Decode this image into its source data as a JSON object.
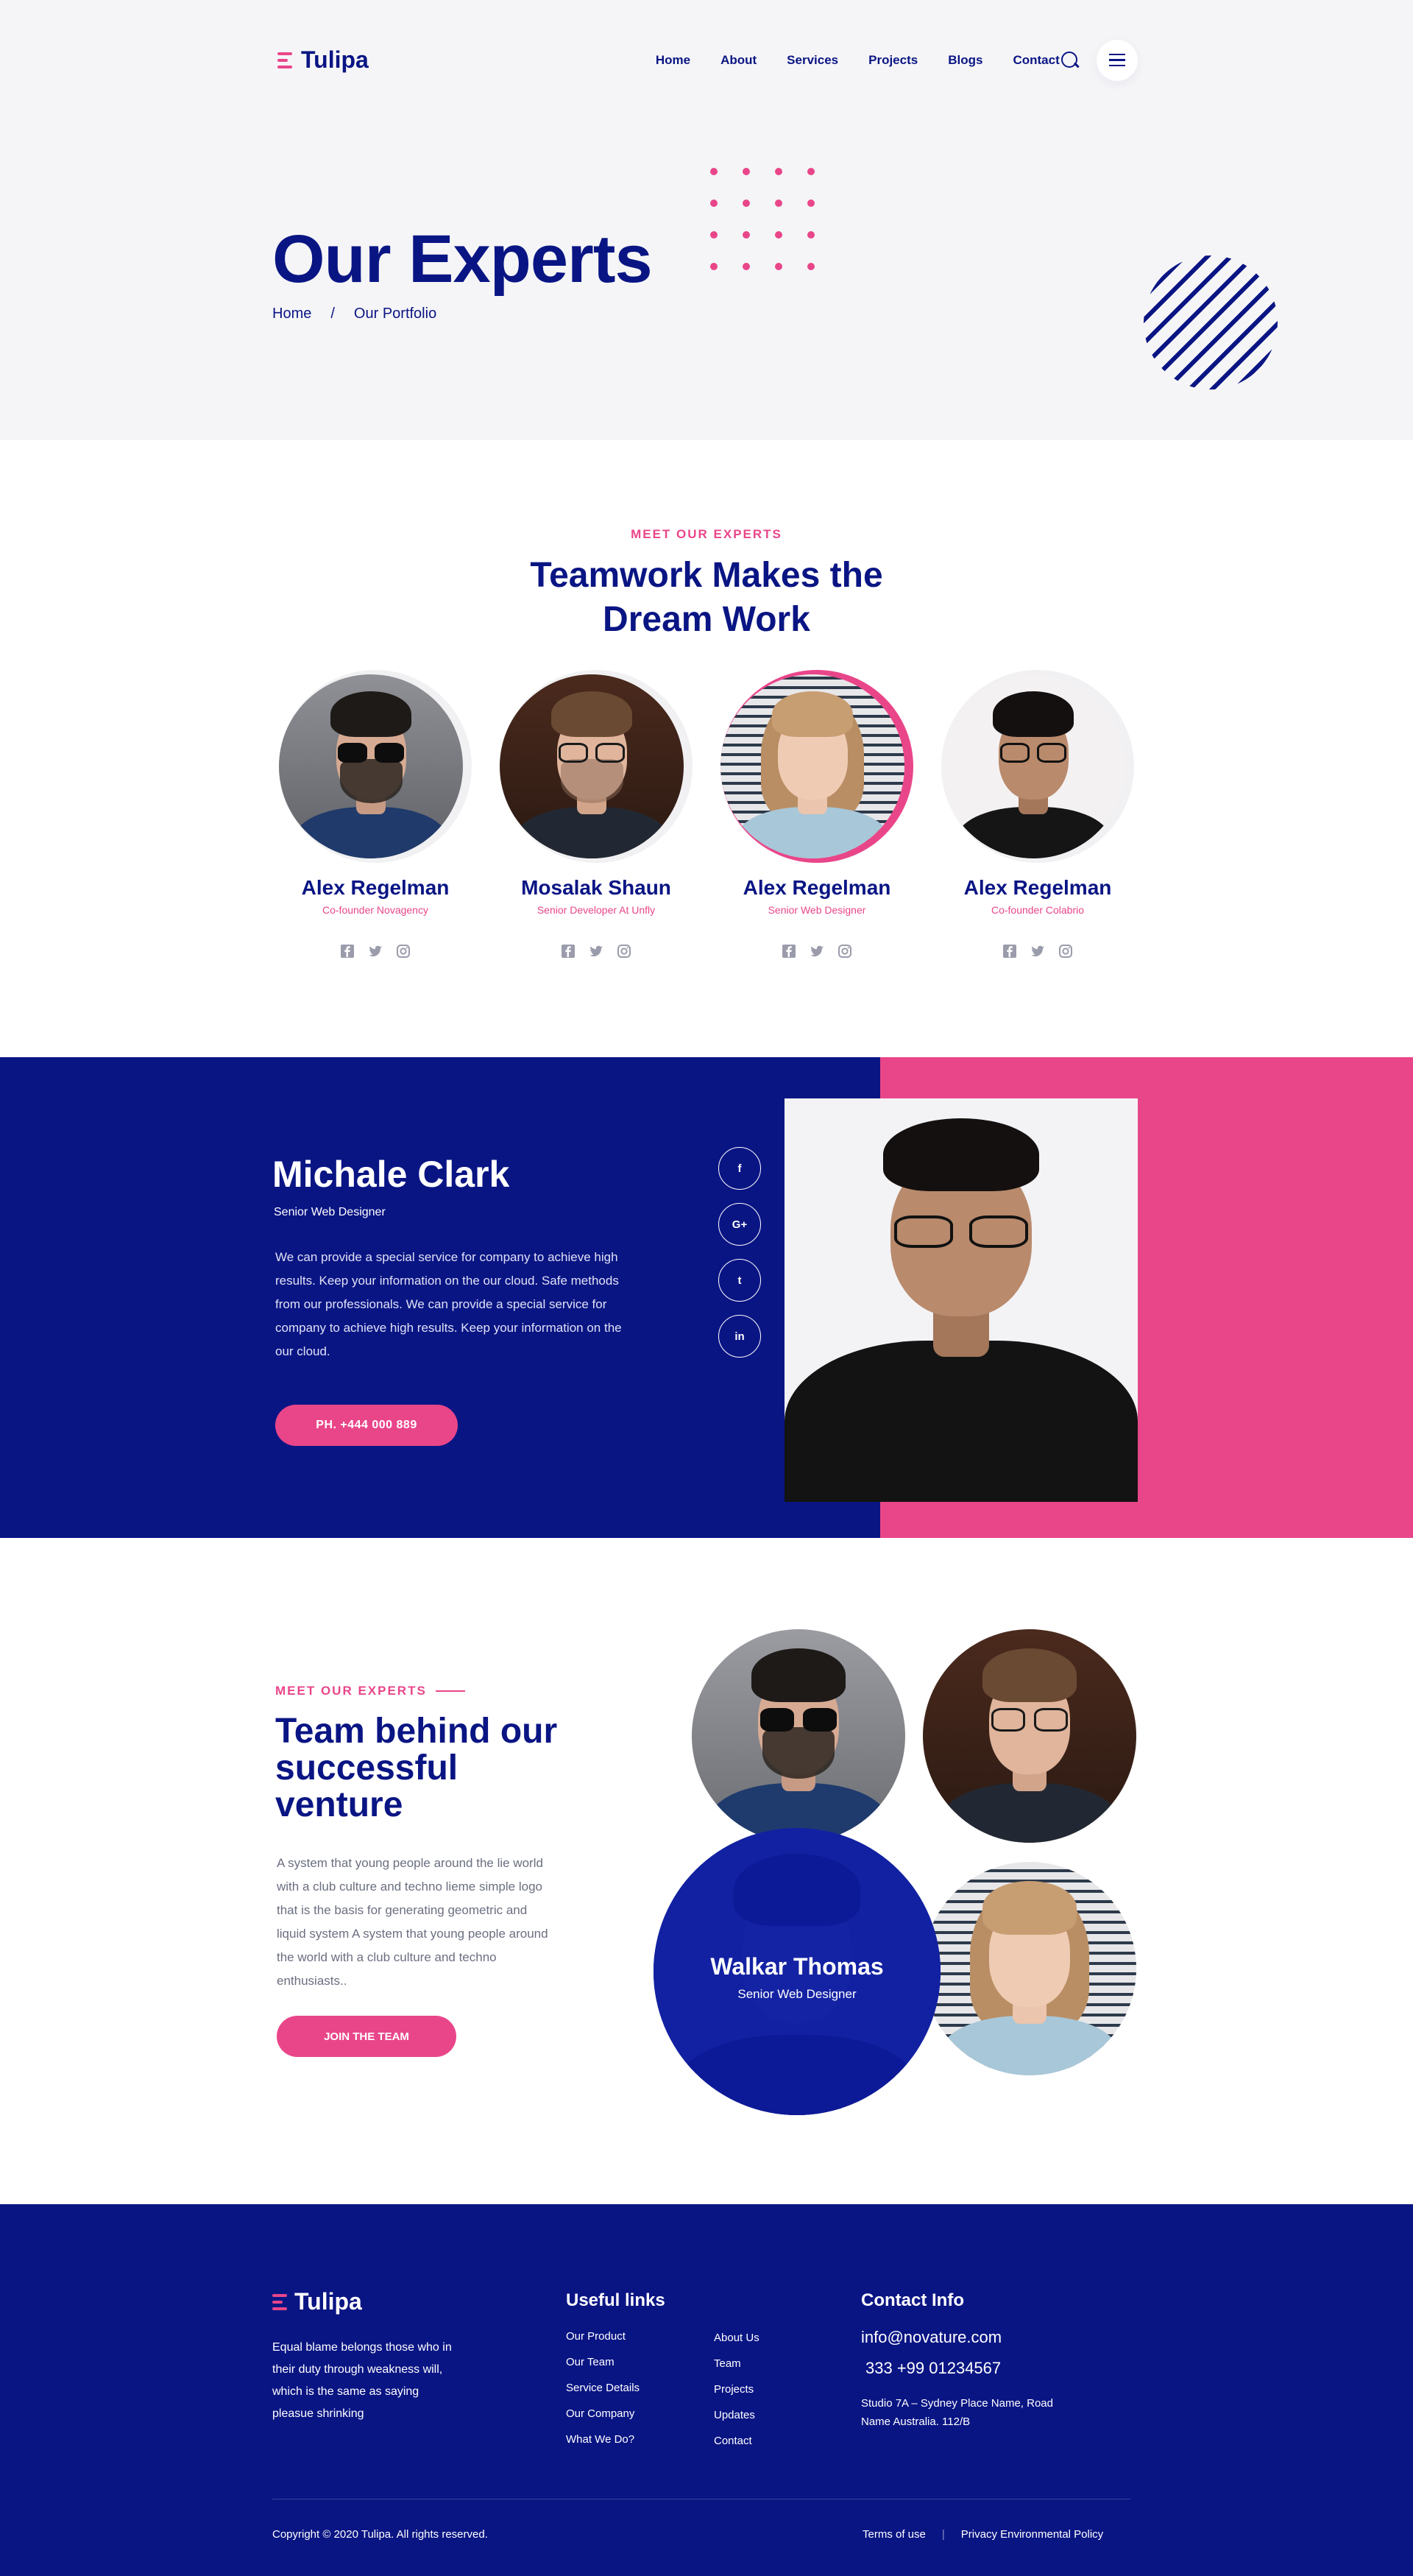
{
  "brand": {
    "name": "Tulipa",
    "accent": "#e9468a",
    "primary": "#0a1584"
  },
  "nav": {
    "items": [
      "Home",
      "About",
      "Services",
      "Projects",
      "Blogs",
      "Contact"
    ],
    "search_icon": "search-icon",
    "menu_icon": "menu-icon"
  },
  "hero": {
    "title": "Our Experts",
    "breadcrumb": [
      "Home",
      "/",
      "Our Portfolio"
    ]
  },
  "team": {
    "eyebrow": "MEET OUR EXPERTS",
    "heading_line1": "Teamwork Makes the",
    "heading_line2": "Dream Work",
    "members": [
      {
        "name": "Alex Regelman",
        "role": "Co-founder Novagency"
      },
      {
        "name": "Mosalak Shaun",
        "role": "Senior Developer At Unfly"
      },
      {
        "name": "Alex Regelman",
        "role": "Senior Web Designer"
      },
      {
        "name": "Alex Regelman",
        "role": "Co-founder Colabrio"
      }
    ],
    "social_icons": [
      "facebook-icon",
      "twitter-icon",
      "instagram-icon"
    ]
  },
  "profile": {
    "name": "Michale Clark",
    "role": "Senior Web Designer",
    "text": "We can provide a special service for company to achieve high results. Keep your information on the our cloud. Safe methods from our professionals. We can provide a special service for company to achieve high results. Keep your information on the our cloud.",
    "phone_label": "PH.  +444 000 889",
    "socials": [
      "f",
      "G+",
      "t",
      "in"
    ]
  },
  "venture": {
    "eyebrow": "MEET OUR EXPERTS",
    "title": "Team behind our successful venture",
    "text": "A system that young people around the lie world with a club culture and techno lieme simple logo that is the basis for generating geometric and liquid system  A system that young people around the world with a club culture and techno enthusiasts..",
    "button": "JOIN THE TEAM",
    "featured_name": "Walkar Thomas",
    "featured_role": "Senior Web Designer"
  },
  "footer": {
    "about": "Equal blame belongs those who in their duty through weakness will, which is the same as saying pleasue shrinking",
    "useful_links_title": "Useful links",
    "links_col1": [
      "Our Product",
      "Our Team",
      "Service Details",
      "Our Company",
      "What We Do?"
    ],
    "links_col2": [
      "About Us",
      "Team",
      "Projects",
      "Updates",
      "Contact"
    ],
    "contact_title": "Contact Info",
    "email": "info@novature.com",
    "phone": "333 +99 01234567",
    "address": "Studio 7A – Sydney Place Name, Road Name Australia. 112/B",
    "copyright": "Copyright © 2020 Tulipa. All rights reserved.",
    "terms": "Terms of use",
    "privacy": "Privacy Environmental Policy"
  }
}
